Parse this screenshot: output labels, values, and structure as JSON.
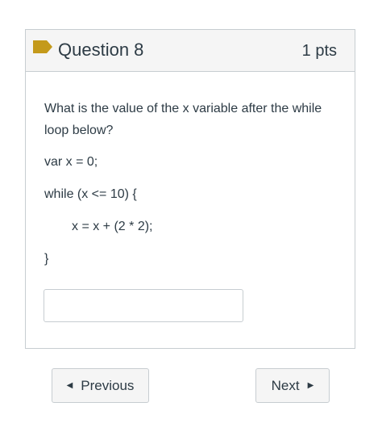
{
  "question": {
    "title": "Question 8",
    "points": "1 pts",
    "flag_icon": "flag-icon",
    "prompt": "What is the value of the x variable after the while loop below?",
    "code": {
      "line1": "var x = 0;",
      "line2": "while (x <= 10) {",
      "line3": "x = x + (2 * 2);",
      "line4": "}"
    },
    "answer_value": ""
  },
  "navigation": {
    "previous_label": "Previous",
    "next_label": "Next",
    "previous_icon": "caret-left-icon",
    "next_icon": "caret-right-icon"
  },
  "colors": {
    "text": "#2d3b45",
    "border": "#c7cdd1",
    "header_bg": "#f5f5f5",
    "flag": "#c49a1b"
  }
}
